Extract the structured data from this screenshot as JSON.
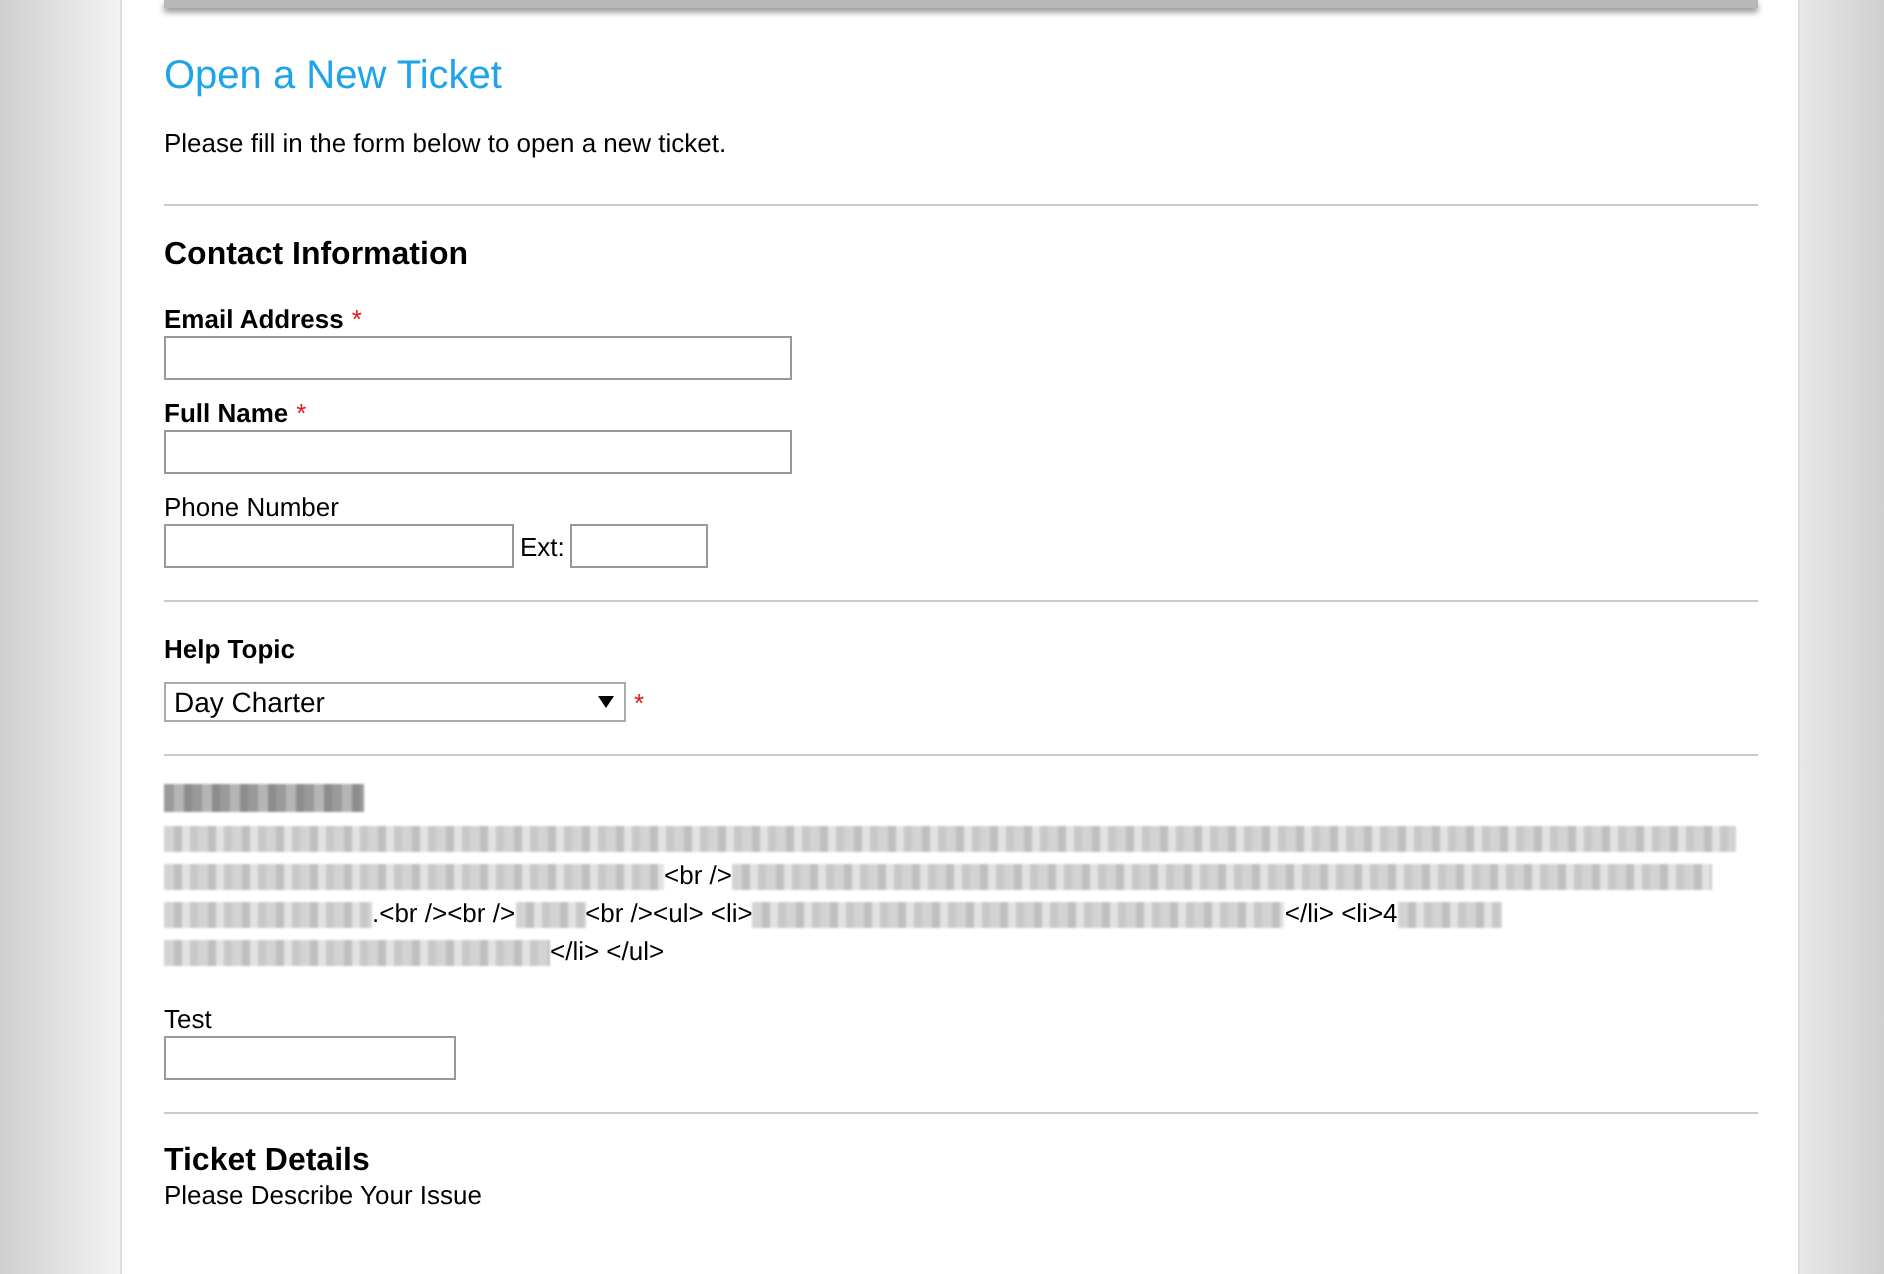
{
  "title": "Open a New Ticket",
  "intro": "Please fill in the form below to open a new ticket.",
  "contact": {
    "heading": "Contact Information",
    "fields": [
      {
        "label": "Email Address",
        "required": true,
        "kind": "text"
      },
      {
        "label": "Full Name",
        "required": true,
        "kind": "text"
      },
      {
        "label": "Phone Number",
        "required": false,
        "kind": "phone",
        "ext_label": "Ext:"
      }
    ]
  },
  "help_topic": {
    "label": "Help Topic",
    "value": "Day Charter",
    "required_mark": "*"
  },
  "topic_description": {
    "segments": [
      {
        "kind": "redacted"
      },
      {
        "kind": "redacted"
      },
      {
        "kind": "redacted"
      },
      {
        "kind": "text",
        "text": "<br />"
      },
      {
        "kind": "redacted"
      },
      {
        "kind": "redacted"
      },
      {
        "kind": "text",
        "text": ".<br /><br />"
      },
      {
        "kind": "redacted"
      },
      {
        "kind": "text",
        "text": "<br /><ul> <li>"
      },
      {
        "kind": "redacted"
      },
      {
        "kind": "text",
        "text": "</li> <li>4"
      },
      {
        "kind": "redacted"
      },
      {
        "kind": "redacted"
      },
      {
        "kind": "text",
        "text": "</li> </ul>"
      }
    ]
  },
  "test_field": {
    "label": "Test"
  },
  "ticket_details": {
    "heading": "Ticket Details",
    "subheading": "Please Describe Your Issue"
  }
}
